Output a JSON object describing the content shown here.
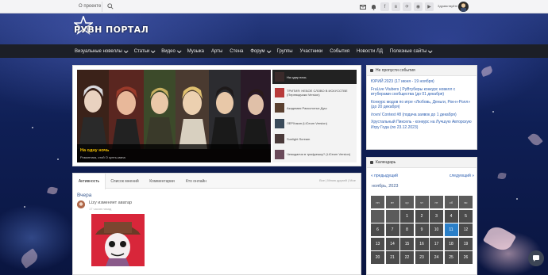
{
  "topbar": {
    "about": "О проекте",
    "search_placeholder": "",
    "hello": "Здравствуйте"
  },
  "logo": {
    "text": "РУВН ПОРТАЛ"
  },
  "nav": [
    {
      "label": "Визуальные новеллы",
      "dropdown": true
    },
    {
      "label": "Статьи",
      "dropdown": true
    },
    {
      "label": "Видео",
      "dropdown": true
    },
    {
      "label": "Музыка",
      "dropdown": false
    },
    {
      "label": "Арты",
      "dropdown": false
    },
    {
      "label": "Стена",
      "dropdown": false
    },
    {
      "label": "Форум",
      "dropdown": true
    },
    {
      "label": "Группы",
      "dropdown": false
    },
    {
      "label": "Участники",
      "dropdown": false
    },
    {
      "label": "События",
      "dropdown": false
    },
    {
      "label": "Новости ЛД",
      "dropdown": false
    },
    {
      "label": "Полезные сайты",
      "dropdown": true
    }
  ],
  "slider": {
    "caption_title": "На одну ночь",
    "caption_sub": "Романтика, отой    О култь-мана",
    "items": [
      {
        "text": "На одну ночь",
        "active": true
      },
      {
        "text": "ТРИТИЯ: НЕБОЕ СЛОВО В ИСКУССТВЕ (Переводчики Version)",
        "active": false
      },
      {
        "text": "Академия Расколотых Душ",
        "active": false
      },
      {
        "text": "ЛЕРХикан (LiCeum Version)",
        "active": false
      },
      {
        "text": "Sunlight Scream",
        "active": false
      },
      {
        "text": "Чемоданчи в трафуешку? (LiCeum Version)",
        "active": false
      }
    ]
  },
  "events": {
    "title": "Не пропусти события",
    "items": [
      "ЮРИЙ 2023 (17 июня - 19 ноября)",
      "FruLive Vtubers | РуВтуберы конкурс новелл с втуберами сообщества (до 01 декабря)",
      "Конкурс модов по игре «Любовь, Деньги, Рок-н-Ролл» (до 20 декабря)",
      "/rovn/ Contest #8 (подача заявок до 1 декабря)",
      "Хрустальный Пиксель - конкурс на Лучшую Авторскую Игру Года (по 23.12.2023)"
    ]
  },
  "calendar": {
    "title": "Календарь",
    "prev": "« предыдущий",
    "next": "следующий »",
    "month": "ноябрь, 2023",
    "dow": [
      "пн",
      "вт",
      "ср",
      "чт",
      "пт",
      "сб",
      "вс"
    ],
    "today": 11,
    "leading_empty": 2,
    "days_shown": 26
  },
  "activity": {
    "tabs": [
      "Активность",
      "Список мнений",
      "Комментарии",
      "Кто онлайн"
    ],
    "filters": "Все | Мною друзей | Мое",
    "day": "Вчера",
    "entry_text": "Lizy изменяет аватар",
    "entry_time": "17 часов назад"
  },
  "colors": {
    "accent": "#2a5db0",
    "nav_bg": "#1c1f27",
    "today": "#2a7fc8",
    "caption_title": "#f5c200"
  }
}
